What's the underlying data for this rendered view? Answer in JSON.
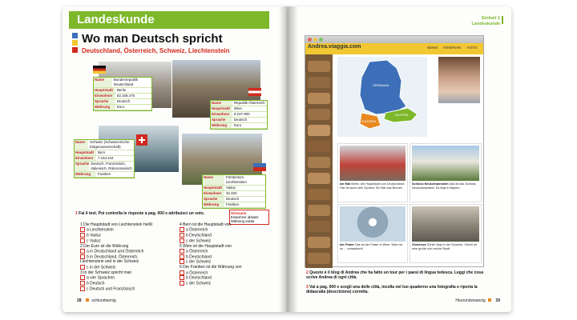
{
  "left_page": {
    "section_label": "Landeskunde",
    "title": "Wo man Deutsch spricht",
    "subtitle": "Deutschland, Österreich, Schweiz, Liechtenstein",
    "boxes": {
      "de": [
        {
          "k": "Name",
          "v": "Bundesrepublik Deutschland"
        },
        {
          "k": "Hauptstadt",
          "v": "Berlin"
        },
        {
          "k": "Einwohner",
          "v": "82.169.475"
        },
        {
          "k": "Sprache",
          "v": "Deutsch"
        },
        {
          "k": "Währung",
          "v": "Euro"
        }
      ],
      "at": [
        {
          "k": "Name",
          "v": "Republik Österreich"
        },
        {
          "k": "Hauptstadt",
          "v": "Wien"
        },
        {
          "k": "Einwohner",
          "v": "8.107.900"
        },
        {
          "k": "Sprache",
          "v": "Deutsch"
        },
        {
          "k": "Währung",
          "v": "Euro"
        }
      ],
      "ch": [
        {
          "k": "Name",
          "v": "Schweiz (Schweizerische Eidgenossenschaft)"
        },
        {
          "k": "Hauptstadt",
          "v": "Bern"
        },
        {
          "k": "Einwohner",
          "v": "7.164.444"
        },
        {
          "k": "Sprache",
          "v": "Deutsch, Französisch, Italienisch, Rätoromanisch"
        },
        {
          "k": "Währung",
          "v": "Franken"
        }
      ],
      "li": [
        {
          "k": "Name",
          "v": "Fürstentum Liechtenstein"
        },
        {
          "k": "Hauptstadt",
          "v": "Vaduz"
        },
        {
          "k": "Einwohner",
          "v": "32.450"
        },
        {
          "k": "Sprache",
          "v": "Deutsch"
        },
        {
          "k": "Währung",
          "v": "Franken"
        }
      ]
    },
    "glossary": {
      "title": "Glossario",
      "term": "Einwohner",
      "translation": "abitanti",
      "term2": "Währung",
      "translation2": "valuta"
    },
    "exercise_num": "1",
    "exercise_text": "Fai il test. Poi controlla le risposte a pag. 000 e attribuisci un voto.",
    "questions_left": [
      {
        "q": "1  Die Hauptstadt von Liechtenstein heißt",
        "a": [
          "a  Liechtenstein",
          "b  Vaduz",
          "c  Vaduz"
        ]
      },
      {
        "q": "2  Der Euro ist die Währung",
        "a": [
          "a  in Deutschland und Österreich",
          "b  in Deutschland, Österreich, Liechtenstein und in der Schweiz",
          "c  in der Schweiz"
        ]
      },
      {
        "q": "3  In der Schweiz spricht man",
        "a": [
          "a  vier Sprachen",
          "b  Deutsch",
          "c  Deutsch und Französisch"
        ]
      }
    ],
    "questions_right": [
      {
        "q": "4  Bern ist die Hauptstadt von",
        "a": [
          "a  Österreich",
          "b  Deutschland",
          "c  der Schweiz"
        ]
      },
      {
        "q": "5  Wien ist die Hauptstadt von",
        "a": [
          "a  Österreich",
          "b  Deutschland",
          "c  der Schweiz"
        ]
      },
      {
        "q": "6  Der Franken ist die Währung von",
        "a": [
          "a  Österreich",
          "b  Deutschland",
          "c  der Schweiz"
        ]
      }
    ],
    "page_number": "28",
    "footer_text": "schlundwenig"
  },
  "right_page": {
    "unit_label": "Einheit 1",
    "unit_sub": "Landeskunde",
    "browser_url": "Andrea.viaggia.com",
    "nav": [
      "NEWS",
      "ITINERARI",
      "FOTO"
    ],
    "map_labels": [
      "GERMANIA",
      "AUSTRIA",
      "SVIZZERA"
    ],
    "tiles": [
      {
        "title": "der Bär",
        "caption": "Berlin, die Hauptstadt von Deutschland. Hier ist auch sein Symbol: Ein Bär aus Bronze."
      },
      {
        "title": "Schloss Neuschwanstein",
        "caption": "Das ist das Schloss Neuschwanstein. Es liegt in Bayern."
      },
      {
        "title": "der Prater",
        "caption": "Das ist der Prater in Wien. Wien ist so ... romantisch!"
      },
      {
        "title": "Zürichsee",
        "caption": "Zürich liegt in der Schweiz. Zürich ist eine große und reiche Stadt."
      }
    ],
    "instruction2_num": "2",
    "instruction2": "Questo è il blog di Andrea che ha fatto un tour per i paesi di lingua tedesca. Leggi che cosa scrive Andrea di ogni città.",
    "instruction3_num": "3",
    "instruction3": "Vai a pag. 000 e scegli una delle città, incolla nel tuo quaderno una fotografia e riporta la didascalia (descrizione) corretta.",
    "footer_text": "Heurundzwanzig",
    "page_number": "29"
  },
  "colors": {
    "green": "#7db82a",
    "red": "#d02a1e",
    "orange": "#e8881e",
    "blue": "#3c6fb8",
    "yellow": "#f2c832"
  }
}
